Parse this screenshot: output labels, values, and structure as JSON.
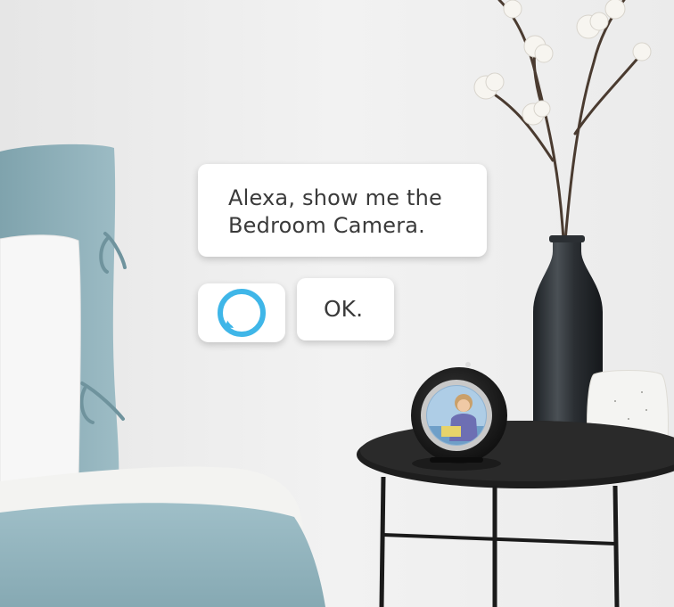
{
  "scene": {
    "description_kind": "photo",
    "colors": {
      "wall": "#ececec",
      "bedding": "#8fb2bc",
      "table": "#1e1e1e",
      "vase_dark": "#2b2f33",
      "vase_white": "#f4f4f2",
      "alexa_ring": "#3fb6e8"
    }
  },
  "conversation": {
    "request_line1": "Alexa, show me the",
    "request_line2": "Bedroom Camera.",
    "reply": "OK."
  },
  "icons": {
    "assistant": "alexa-logo-icon"
  }
}
